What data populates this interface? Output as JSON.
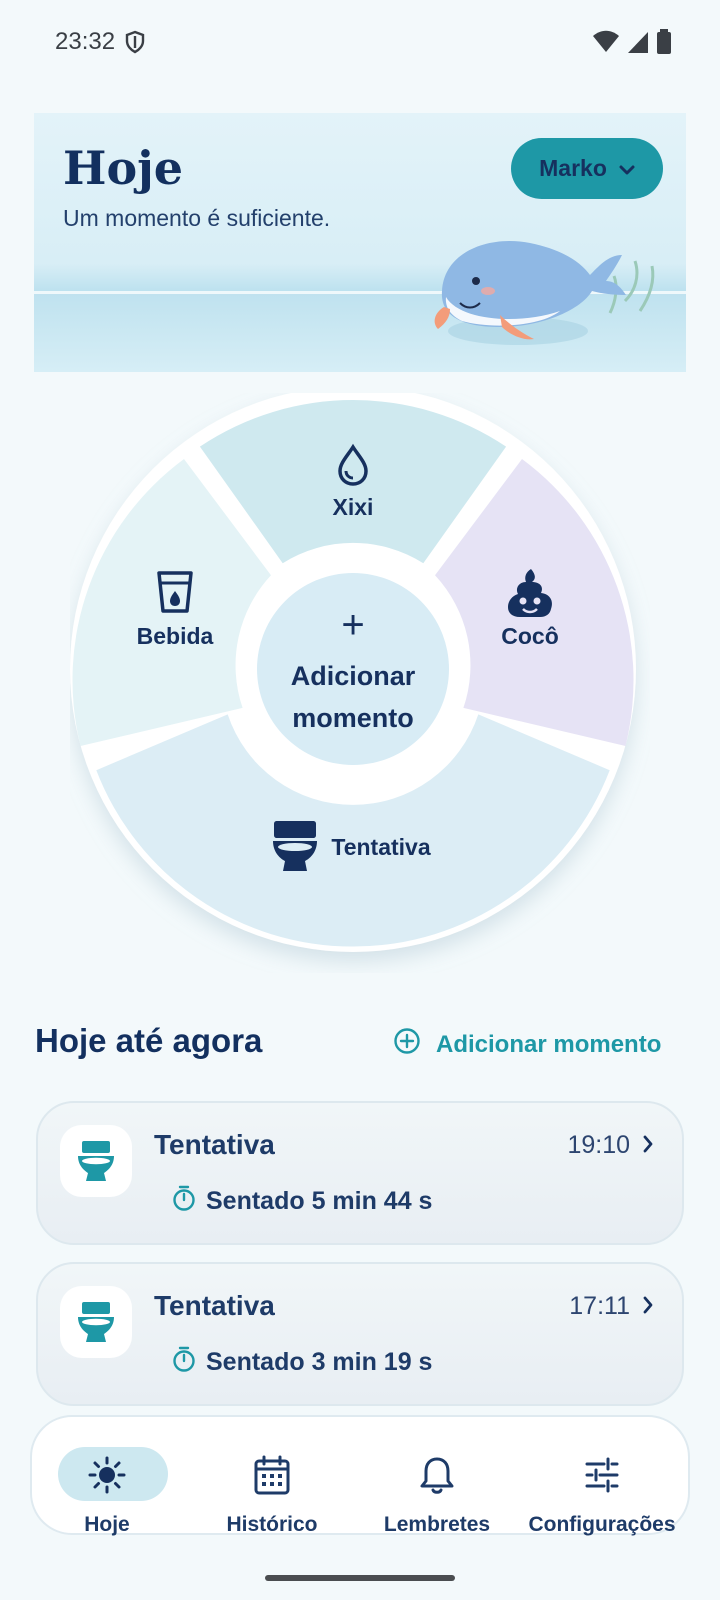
{
  "status_bar": {
    "time": "23:32"
  },
  "header": {
    "title": "Hoje",
    "subtitle": "Um momento é suficiente.",
    "profile_name": "Marko"
  },
  "wheel": {
    "segments": [
      {
        "label": "Xixi",
        "icon": "drop-icon",
        "color": "#cfe9ef"
      },
      {
        "label": "Cocô",
        "icon": "poop-icon",
        "color": "#e6e3f5"
      },
      {
        "label": "Tentativa",
        "icon": "toilet-icon",
        "color": "#dcedf5"
      },
      {
        "label": "Bebida",
        "icon": "cup-icon",
        "color": "#e4f3f6"
      }
    ],
    "center_icon": "+",
    "center_line1": "Adicionar",
    "center_line2": "momento"
  },
  "today": {
    "title": "Hoje até agora",
    "add_label": "Adicionar momento",
    "entries": [
      {
        "title": "Tentativa",
        "time": "19:10",
        "detail": "Sentado 5 min 44 s",
        "icon": "toilet-icon"
      },
      {
        "title": "Tentativa",
        "time": "17:11",
        "detail": "Sentado 3 min 19 s",
        "icon": "toilet-icon"
      }
    ]
  },
  "nav": {
    "items": [
      {
        "label": "Hoje",
        "icon": "sun-icon",
        "active": true
      },
      {
        "label": "Histórico",
        "icon": "calendar-icon",
        "active": false
      },
      {
        "label": "Lembretes",
        "icon": "bell-icon",
        "active": false
      },
      {
        "label": "Configurações",
        "icon": "sliders-icon",
        "active": false
      }
    ]
  },
  "colors": {
    "accent": "#1e98a6",
    "navy": "#16305e",
    "background": "#f3f9fb"
  }
}
